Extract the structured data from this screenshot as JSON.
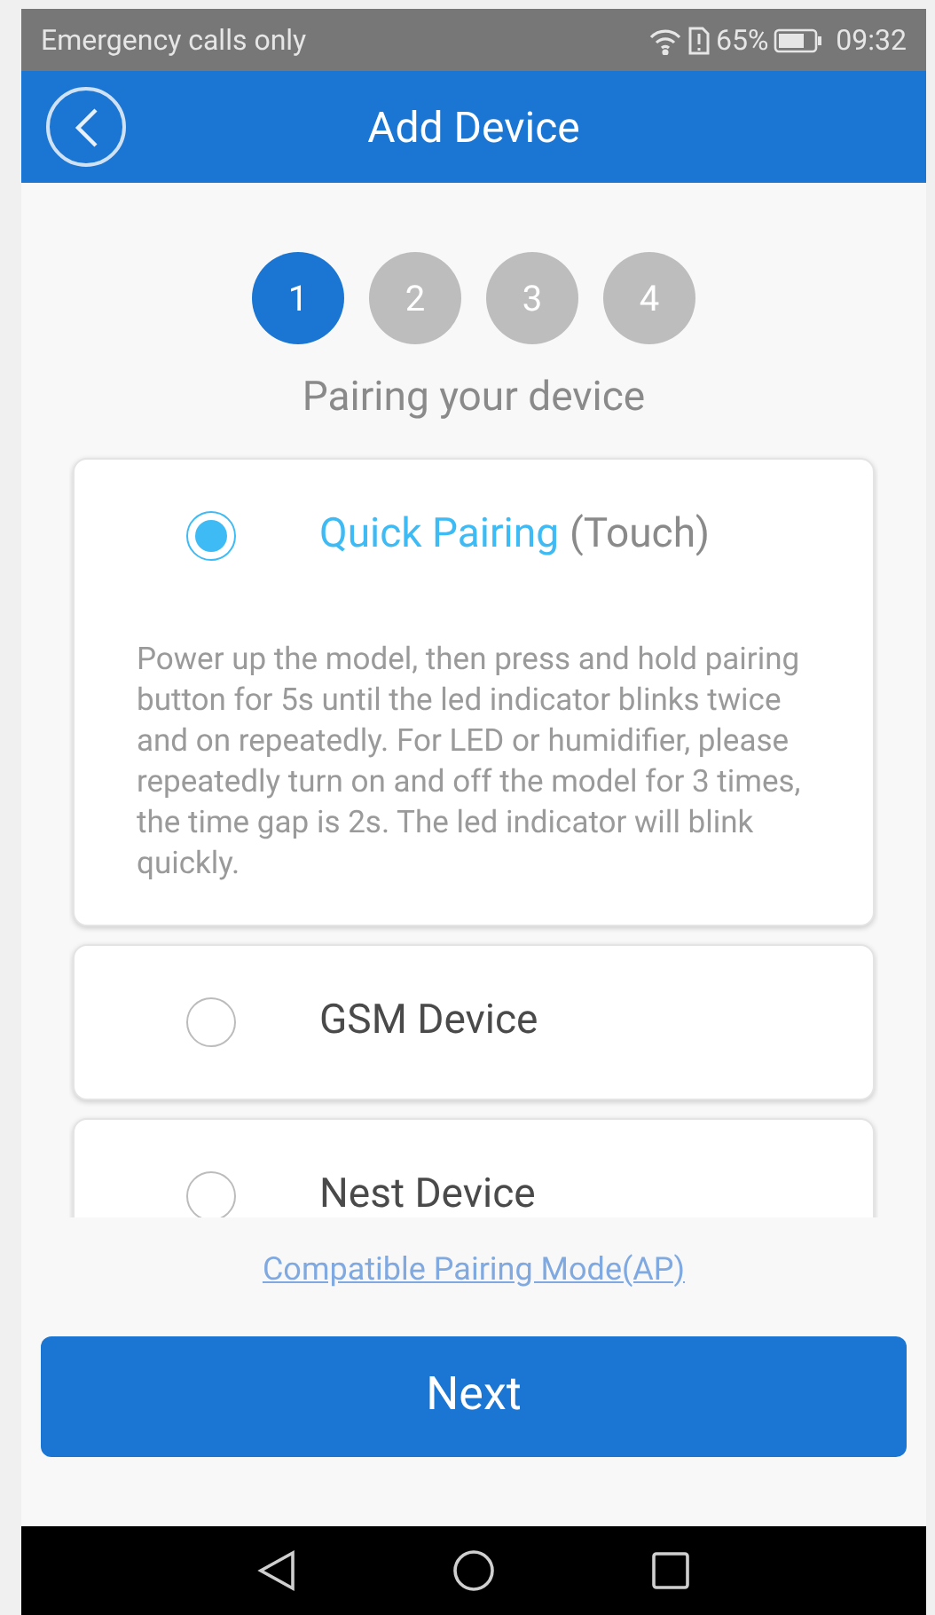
{
  "status_bar": {
    "carrier": "Emergency calls only",
    "battery": "65%",
    "time": "09:32"
  },
  "header": {
    "title": "Add Device"
  },
  "steps": [
    {
      "label": "1",
      "selected": true
    },
    {
      "label": "2",
      "selected": false
    },
    {
      "label": "3",
      "selected": false
    },
    {
      "label": "4",
      "selected": false
    }
  ],
  "subtitle": "Pairing your device",
  "options": [
    {
      "title": "Quick Pairing",
      "note": "(Touch)",
      "description": "Power up the model, then press and hold pairing button for 5s until the led indicator blinks twice and on repeatedly. For LED or humidifier, please repeatedly turn on and off the model for 3 times, the time gap is 2s. The led indicator will blink quickly.",
      "selected": true
    },
    {
      "title": "GSM Device",
      "selected": false
    },
    {
      "title": "Nest Device",
      "selected": false
    }
  ],
  "link": "Compatible Pairing Mode(AP)",
  "next_button": "Next"
}
